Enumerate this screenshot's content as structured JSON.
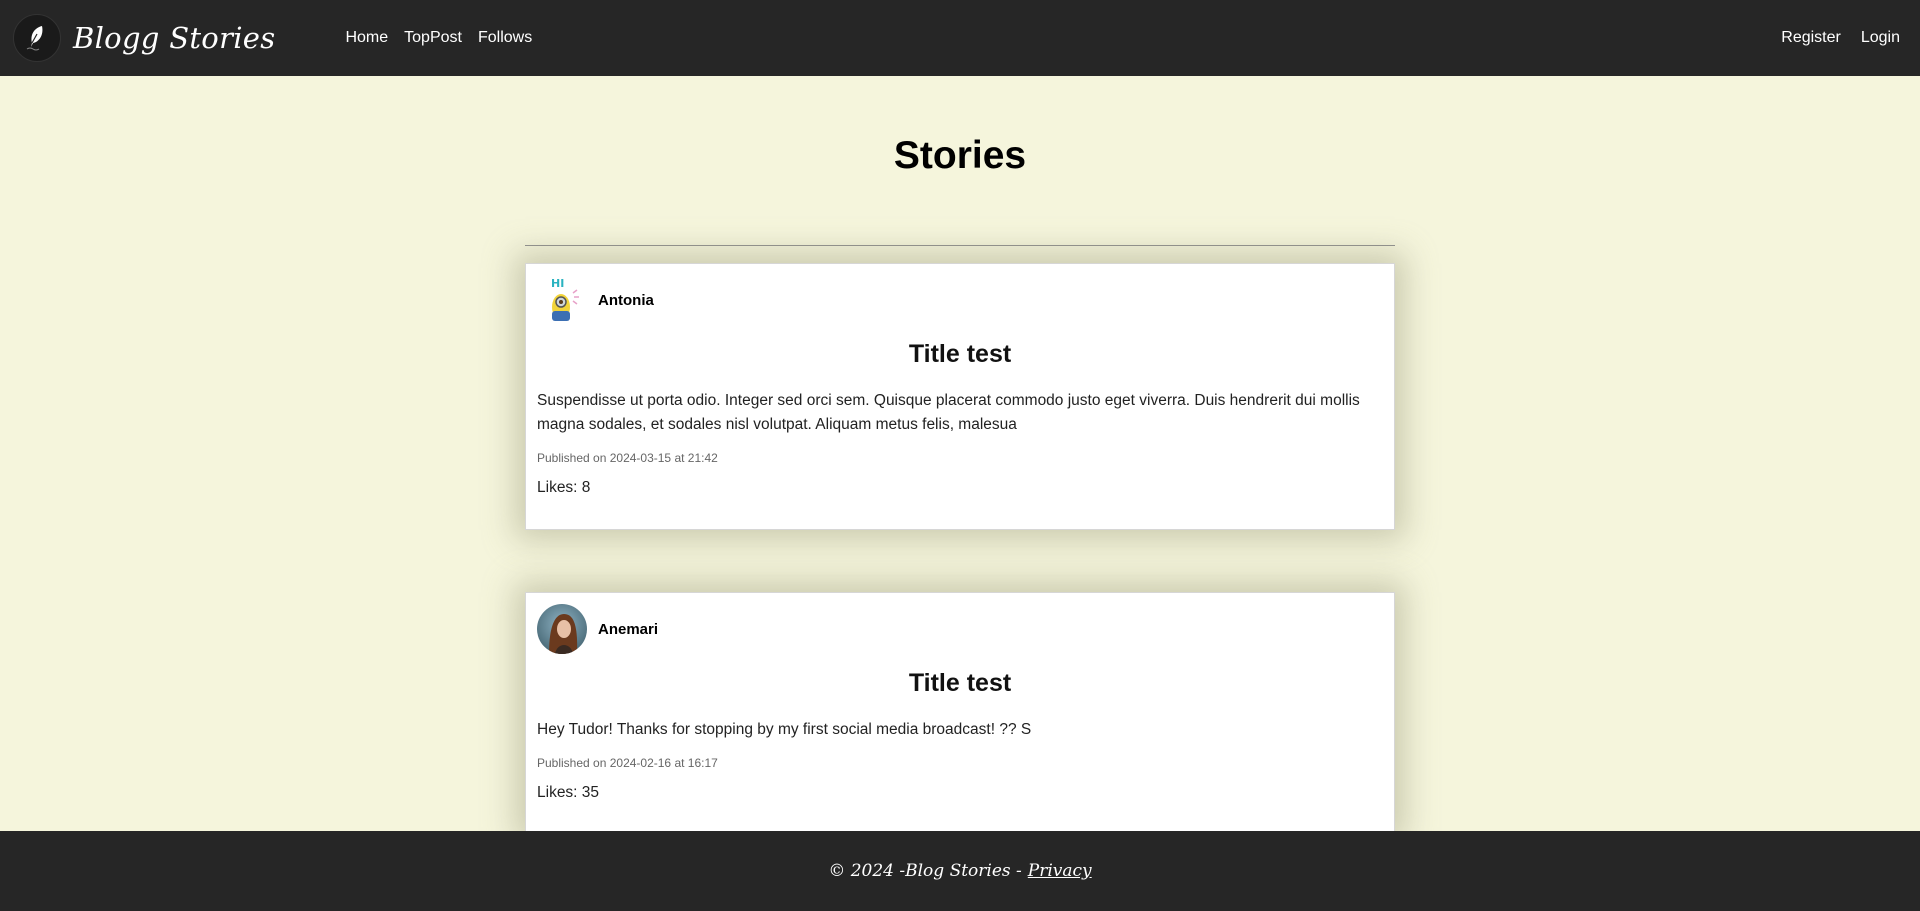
{
  "brand": {
    "name": "Blogg Stories"
  },
  "nav": {
    "links": [
      "Home",
      "TopPost",
      "Follows"
    ],
    "right": [
      "Register",
      "Login"
    ]
  },
  "main": {
    "title": "Stories",
    "posts": [
      {
        "author": "Antonia",
        "avatar_text": "HI",
        "title": "Title test",
        "body": "Suspendisse ut porta odio. Integer sed orci sem. Quisque placerat commodo justo eget viverra. Duis hendrerit dui mollis magna sodales, et sodales nisl volutpat. Aliquam metus felis, malesua",
        "date": "Published on 2024-03-15 at 21:42",
        "likes": "Likes: 8"
      },
      {
        "author": "Anemari",
        "title": "Title test",
        "body": "Hey Tudor! Thanks for stopping by my first social media broadcast! ?? S",
        "date": "Published on 2024-02-16 at 16:17",
        "likes": "Likes: 35"
      }
    ]
  },
  "footer": {
    "text": "© 2024 -Blog Stories -",
    "link": "Privacy"
  },
  "colors": {
    "navbar": "#262626",
    "background": "#f5f5dc",
    "card": "#ffffff"
  }
}
